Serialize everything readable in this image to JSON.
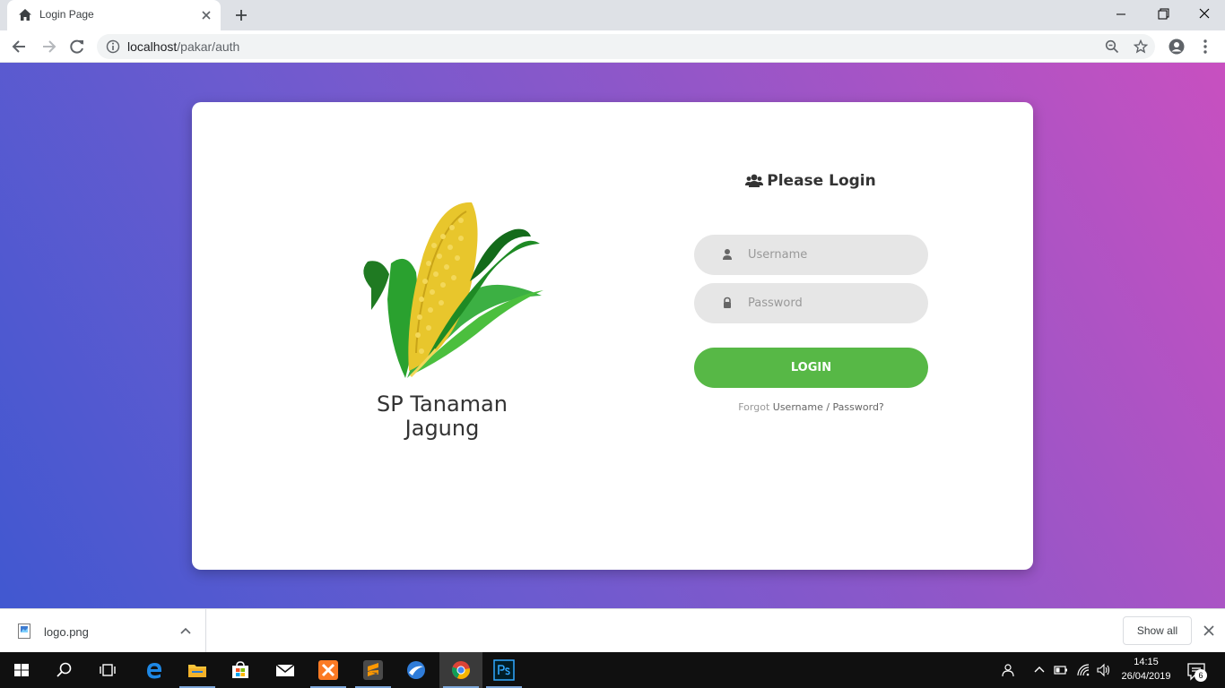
{
  "browser": {
    "tab_title": "Login Page",
    "url_host": "localhost",
    "url_path": "/pakar/auth"
  },
  "page": {
    "brand_line1": "SP Tanaman",
    "brand_line2": "Jagung",
    "form_title": "Please Login",
    "username_placeholder": "Username",
    "password_placeholder": "Password",
    "login_label": "LOGIN",
    "forgot_prefix": "Forgot",
    "forgot_username": "Username",
    "forgot_sep": " / ",
    "forgot_password": "Password?"
  },
  "downloads": {
    "file_name": "logo.png",
    "show_all_label": "Show all"
  },
  "taskbar": {
    "time": "14:15",
    "date": "26/04/2019",
    "notification_count": "6"
  },
  "colors": {
    "gradient_start": "#c850c0",
    "gradient_end": "#4158d0",
    "login_button": "#57b846",
    "field_bg": "#e6e6e6"
  },
  "icons": [
    "home-icon",
    "close-icon",
    "plus-icon",
    "minimize-icon",
    "restore-icon",
    "back-icon",
    "forward-icon",
    "reload-icon",
    "info-icon",
    "zoom-icon",
    "star-icon",
    "account-icon",
    "menu-icon",
    "users-icon",
    "user-icon",
    "lock-icon",
    "image-file-icon",
    "chevron-up-icon",
    "windows-icon",
    "search-icon",
    "task-view-icon",
    "edge-icon",
    "folder-icon",
    "store-icon",
    "mail-icon",
    "xampp-icon",
    "sublime-icon",
    "browser-icon",
    "chrome-icon",
    "photoshop-icon",
    "people-icon",
    "battery-icon",
    "wifi-icon",
    "volume-icon",
    "notification-icon"
  ]
}
